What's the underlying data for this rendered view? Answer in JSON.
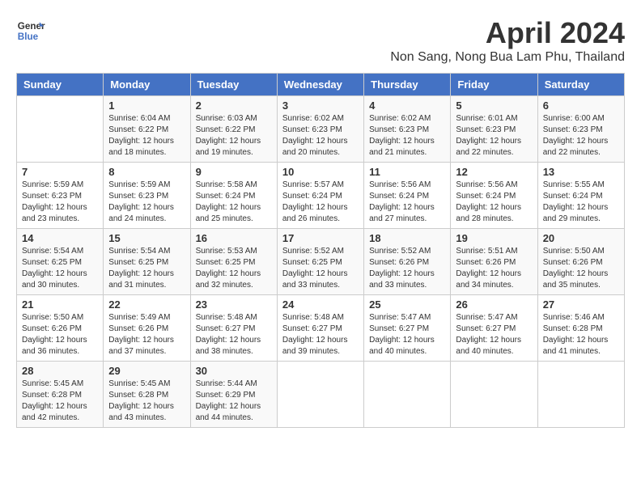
{
  "header": {
    "logo_line1": "General",
    "logo_line2": "Blue",
    "month_title": "April 2024",
    "location": "Non Sang, Nong Bua Lam Phu, Thailand"
  },
  "days_of_week": [
    "Sunday",
    "Monday",
    "Tuesday",
    "Wednesday",
    "Thursday",
    "Friday",
    "Saturday"
  ],
  "weeks": [
    [
      {
        "day": "",
        "sunrise": "",
        "sunset": "",
        "daylight": ""
      },
      {
        "day": "1",
        "sunrise": "Sunrise: 6:04 AM",
        "sunset": "Sunset: 6:22 PM",
        "daylight": "Daylight: 12 hours and 18 minutes."
      },
      {
        "day": "2",
        "sunrise": "Sunrise: 6:03 AM",
        "sunset": "Sunset: 6:22 PM",
        "daylight": "Daylight: 12 hours and 19 minutes."
      },
      {
        "day": "3",
        "sunrise": "Sunrise: 6:02 AM",
        "sunset": "Sunset: 6:23 PM",
        "daylight": "Daylight: 12 hours and 20 minutes."
      },
      {
        "day": "4",
        "sunrise": "Sunrise: 6:02 AM",
        "sunset": "Sunset: 6:23 PM",
        "daylight": "Daylight: 12 hours and 21 minutes."
      },
      {
        "day": "5",
        "sunrise": "Sunrise: 6:01 AM",
        "sunset": "Sunset: 6:23 PM",
        "daylight": "Daylight: 12 hours and 22 minutes."
      },
      {
        "day": "6",
        "sunrise": "Sunrise: 6:00 AM",
        "sunset": "Sunset: 6:23 PM",
        "daylight": "Daylight: 12 hours and 22 minutes."
      }
    ],
    [
      {
        "day": "7",
        "sunrise": "Sunrise: 5:59 AM",
        "sunset": "Sunset: 6:23 PM",
        "daylight": "Daylight: 12 hours and 23 minutes."
      },
      {
        "day": "8",
        "sunrise": "Sunrise: 5:59 AM",
        "sunset": "Sunset: 6:23 PM",
        "daylight": "Daylight: 12 hours and 24 minutes."
      },
      {
        "day": "9",
        "sunrise": "Sunrise: 5:58 AM",
        "sunset": "Sunset: 6:24 PM",
        "daylight": "Daylight: 12 hours and 25 minutes."
      },
      {
        "day": "10",
        "sunrise": "Sunrise: 5:57 AM",
        "sunset": "Sunset: 6:24 PM",
        "daylight": "Daylight: 12 hours and 26 minutes."
      },
      {
        "day": "11",
        "sunrise": "Sunrise: 5:56 AM",
        "sunset": "Sunset: 6:24 PM",
        "daylight": "Daylight: 12 hours and 27 minutes."
      },
      {
        "day": "12",
        "sunrise": "Sunrise: 5:56 AM",
        "sunset": "Sunset: 6:24 PM",
        "daylight": "Daylight: 12 hours and 28 minutes."
      },
      {
        "day": "13",
        "sunrise": "Sunrise: 5:55 AM",
        "sunset": "Sunset: 6:24 PM",
        "daylight": "Daylight: 12 hours and 29 minutes."
      }
    ],
    [
      {
        "day": "14",
        "sunrise": "Sunrise: 5:54 AM",
        "sunset": "Sunset: 6:25 PM",
        "daylight": "Daylight: 12 hours and 30 minutes."
      },
      {
        "day": "15",
        "sunrise": "Sunrise: 5:54 AM",
        "sunset": "Sunset: 6:25 PM",
        "daylight": "Daylight: 12 hours and 31 minutes."
      },
      {
        "day": "16",
        "sunrise": "Sunrise: 5:53 AM",
        "sunset": "Sunset: 6:25 PM",
        "daylight": "Daylight: 12 hours and 32 minutes."
      },
      {
        "day": "17",
        "sunrise": "Sunrise: 5:52 AM",
        "sunset": "Sunset: 6:25 PM",
        "daylight": "Daylight: 12 hours and 33 minutes."
      },
      {
        "day": "18",
        "sunrise": "Sunrise: 5:52 AM",
        "sunset": "Sunset: 6:26 PM",
        "daylight": "Daylight: 12 hours and 33 minutes."
      },
      {
        "day": "19",
        "sunrise": "Sunrise: 5:51 AM",
        "sunset": "Sunset: 6:26 PM",
        "daylight": "Daylight: 12 hours and 34 minutes."
      },
      {
        "day": "20",
        "sunrise": "Sunrise: 5:50 AM",
        "sunset": "Sunset: 6:26 PM",
        "daylight": "Daylight: 12 hours and 35 minutes."
      }
    ],
    [
      {
        "day": "21",
        "sunrise": "Sunrise: 5:50 AM",
        "sunset": "Sunset: 6:26 PM",
        "daylight": "Daylight: 12 hours and 36 minutes."
      },
      {
        "day": "22",
        "sunrise": "Sunrise: 5:49 AM",
        "sunset": "Sunset: 6:26 PM",
        "daylight": "Daylight: 12 hours and 37 minutes."
      },
      {
        "day": "23",
        "sunrise": "Sunrise: 5:48 AM",
        "sunset": "Sunset: 6:27 PM",
        "daylight": "Daylight: 12 hours and 38 minutes."
      },
      {
        "day": "24",
        "sunrise": "Sunrise: 5:48 AM",
        "sunset": "Sunset: 6:27 PM",
        "daylight": "Daylight: 12 hours and 39 minutes."
      },
      {
        "day": "25",
        "sunrise": "Sunrise: 5:47 AM",
        "sunset": "Sunset: 6:27 PM",
        "daylight": "Daylight: 12 hours and 40 minutes."
      },
      {
        "day": "26",
        "sunrise": "Sunrise: 5:47 AM",
        "sunset": "Sunset: 6:27 PM",
        "daylight": "Daylight: 12 hours and 40 minutes."
      },
      {
        "day": "27",
        "sunrise": "Sunrise: 5:46 AM",
        "sunset": "Sunset: 6:28 PM",
        "daylight": "Daylight: 12 hours and 41 minutes."
      }
    ],
    [
      {
        "day": "28",
        "sunrise": "Sunrise: 5:45 AM",
        "sunset": "Sunset: 6:28 PM",
        "daylight": "Daylight: 12 hours and 42 minutes."
      },
      {
        "day": "29",
        "sunrise": "Sunrise: 5:45 AM",
        "sunset": "Sunset: 6:28 PM",
        "daylight": "Daylight: 12 hours and 43 minutes."
      },
      {
        "day": "30",
        "sunrise": "Sunrise: 5:44 AM",
        "sunset": "Sunset: 6:29 PM",
        "daylight": "Daylight: 12 hours and 44 minutes."
      },
      {
        "day": "",
        "sunrise": "",
        "sunset": "",
        "daylight": ""
      },
      {
        "day": "",
        "sunrise": "",
        "sunset": "",
        "daylight": ""
      },
      {
        "day": "",
        "sunrise": "",
        "sunset": "",
        "daylight": ""
      },
      {
        "day": "",
        "sunrise": "",
        "sunset": "",
        "daylight": ""
      }
    ]
  ]
}
